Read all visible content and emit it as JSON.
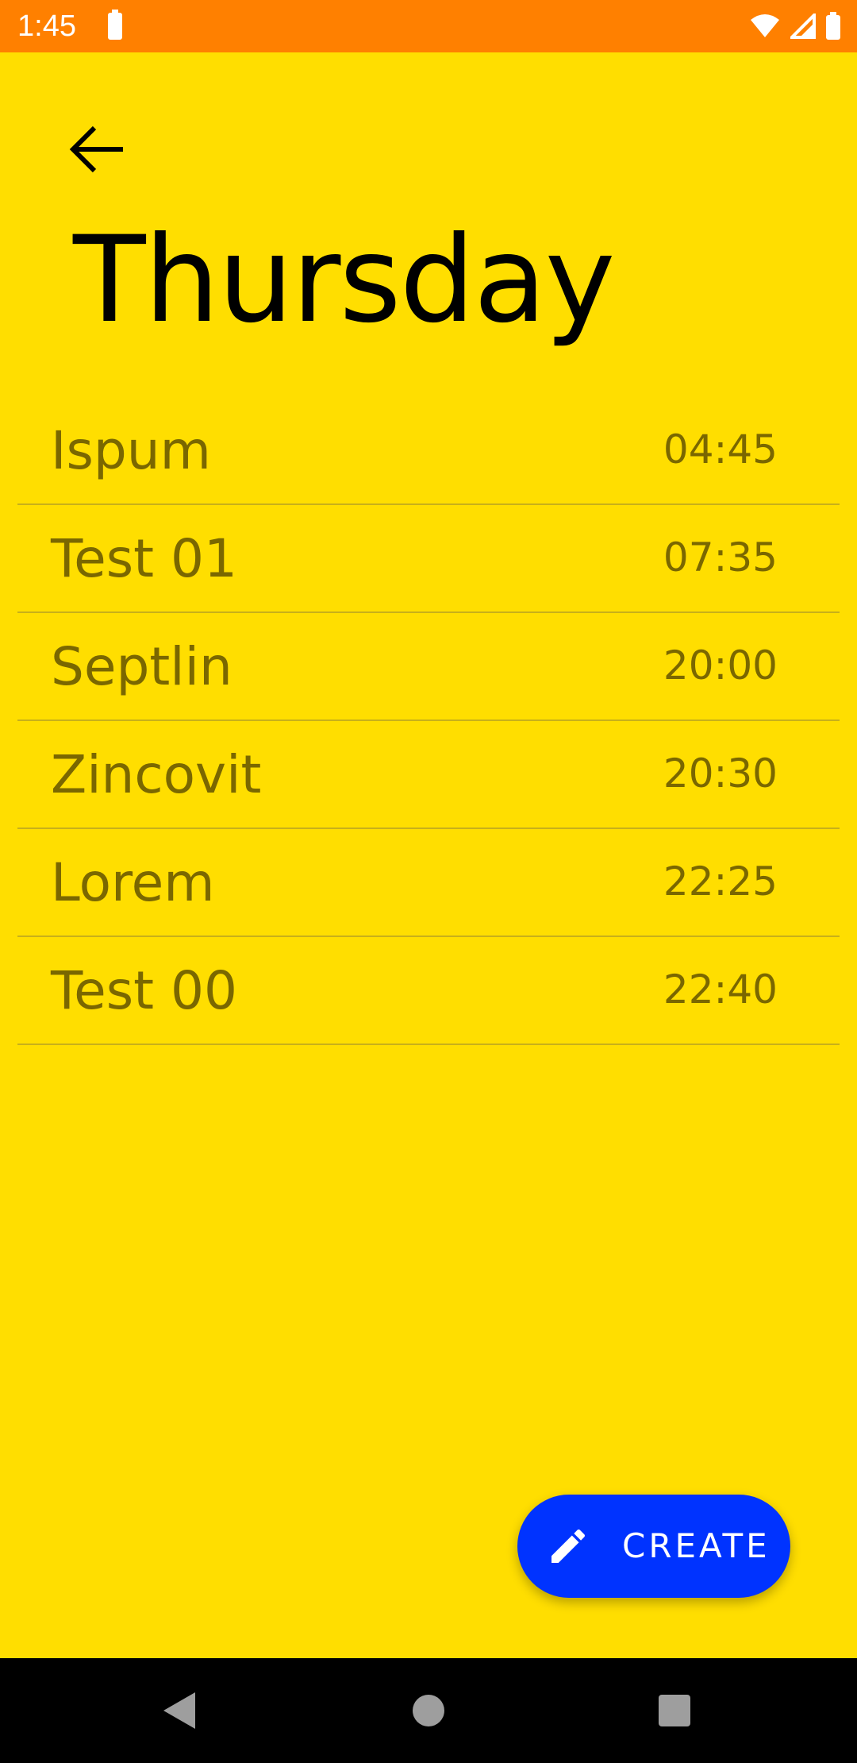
{
  "status_bar": {
    "time": "1:45",
    "icons": [
      "battery-icon",
      "wifi-icon",
      "signal-icon",
      "battery-icon"
    ]
  },
  "header": {
    "back_icon": "arrow-left-icon",
    "title": "Thursday"
  },
  "schedule": {
    "items": [
      {
        "name": "Ispum",
        "time": "04:45"
      },
      {
        "name": "Test 01",
        "time": "07:35"
      },
      {
        "name": "Septlin",
        "time": "20:00"
      },
      {
        "name": "Zincovit",
        "time": "20:30"
      },
      {
        "name": "Lorem",
        "time": "22:25"
      },
      {
        "name": "Test 00",
        "time": "22:40"
      }
    ]
  },
  "fab": {
    "icon": "pencil-icon",
    "label": "CREATE"
  },
  "nav_bar": {
    "icons": [
      "back-triangle-icon",
      "home-circle-icon",
      "recents-square-icon"
    ]
  },
  "colors": {
    "background": "#FFDE00",
    "status_bar": "#FF8000",
    "accent": "#0033FF",
    "item_text": "#7A6700",
    "divider": "#C8B01A"
  }
}
